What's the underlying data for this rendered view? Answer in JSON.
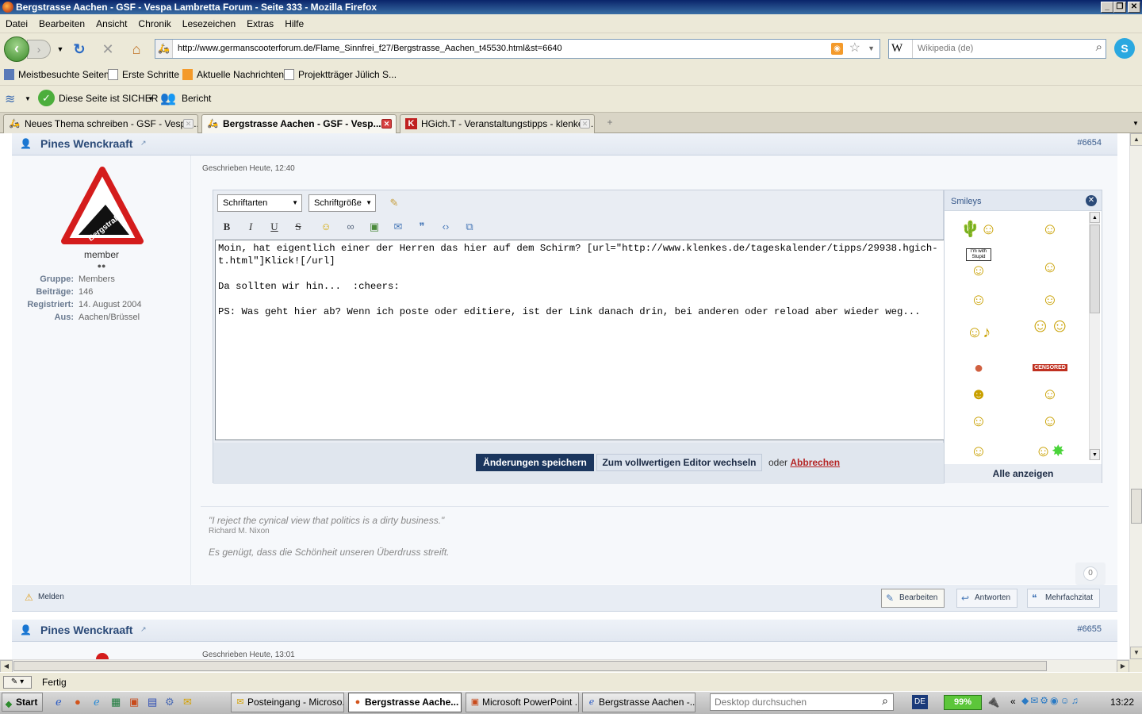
{
  "window": {
    "title": "Bergstrasse Aachen - GSF - Vespa Lambretta Forum - Seite 333 - Mozilla Firefox"
  },
  "menu": [
    "Datei",
    "Bearbeiten",
    "Ansicht",
    "Chronik",
    "Lesezeichen",
    "Extras",
    "Hilfe"
  ],
  "nav": {
    "url": "http://www.germanscooterforum.de/Flame_Sinnfrei_f27/Bergstrasse_Aachen_t45530.html&st=6640",
    "search_placeholder": "Wikipedia (de)",
    "search_engine": "W"
  },
  "bookmarks": [
    "Meistbesuchte Seiten",
    "Erste Schritte",
    "Aktuelle Nachrichten",
    "Projektträger Jülich S..."
  ],
  "security": {
    "status": "Diese Seite ist SICHER",
    "report": "Bericht"
  },
  "tabs": [
    {
      "title": "Neues Thema schreiben - GSF - Vespa ...",
      "active": false
    },
    {
      "title": "Bergstrasse Aachen - GSF - Vesp...",
      "active": true
    },
    {
      "title": "HGich.T - Veranstaltungstipps - klenkes...",
      "active": false
    }
  ],
  "post": {
    "author": "Pines Wenckraaft",
    "number": "#6654",
    "written": "Geschrieben Heute, 12:40",
    "avatar_text": "Bergstraße",
    "rank": "member",
    "details": [
      {
        "label": "Gruppe:",
        "value": "Members"
      },
      {
        "label": "Beiträge:",
        "value": "146"
      },
      {
        "label": "Registriert:",
        "value": "14. August 2004"
      },
      {
        "label": "Aus:",
        "value": "Aachen/Brüssel"
      }
    ]
  },
  "editor": {
    "font_select": "Schriftarten",
    "size_select": "Schriftgröße",
    "text": "Moin, hat eigentlich einer der Herren das hier auf dem Schirm? [url=\"http://www.klenkes.de/tageskalender/tipps/29938.hgich-t.html\"]Klick![/url]\n\nDa sollten wir hin...  :cheers:\n\nPS: Was geht hier ab? Wenn ich poste oder editiere, ist der Link danach drin, bei anderen oder reload aber wieder weg...",
    "save_label": "Änderungen speichern",
    "switch_label": "Zum vollwertigen Editor wechseln",
    "or_label": "oder",
    "cancel_label": "Abbrechen"
  },
  "smileys": {
    "title": "Smileys",
    "show_all": "Alle anzeigen",
    "sign_text": "I'm with Stupid",
    "censored_text": "CENSORED"
  },
  "signature": {
    "quote": "\"I reject the cynical view that politics is a dirty business.\"",
    "attribution": "Richard M. Nixon",
    "line2": "Es genügt, dass die Schönheit unseren Überdruss streift."
  },
  "reputation": "0",
  "actions": {
    "report": "Melden",
    "edit": "Bearbeiten",
    "reply": "Antworten",
    "multiquote": "Mehrfachzitat"
  },
  "next_post": {
    "author": "Pines Wenckraaft",
    "number": "#6655",
    "written": "Geschrieben Heute, 13:01"
  },
  "status": {
    "text": "Fertig"
  },
  "taskbar": {
    "start": "Start",
    "tasks": [
      "Posteingang - Microso...",
      "Bergstrasse Aache...",
      "Microsoft PowerPoint ...",
      "Bergstrasse Aachen -..."
    ],
    "search_placeholder": "Desktop durchsuchen",
    "lang": "DE",
    "battery": "99%",
    "clock": "13:22"
  }
}
